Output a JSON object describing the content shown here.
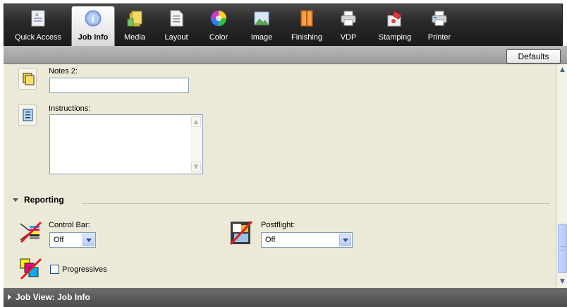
{
  "tabs": [
    {
      "label": "Quick Access",
      "icon": "quick-access-icon"
    },
    {
      "label": "Job Info",
      "icon": "info-icon",
      "active": true
    },
    {
      "label": "Media",
      "icon": "media-icon"
    },
    {
      "label": "Layout",
      "icon": "layout-icon"
    },
    {
      "label": "Color",
      "icon": "color-wheel-icon"
    },
    {
      "label": "Image",
      "icon": "image-icon"
    },
    {
      "label": "Finishing",
      "icon": "finishing-icon"
    },
    {
      "label": "VDP",
      "icon": "vdp-icon"
    },
    {
      "label": "Stamping",
      "icon": "stamping-icon"
    },
    {
      "label": "Printer",
      "icon": "printer-icon"
    }
  ],
  "toolbar": {
    "defaults_label": "Defaults"
  },
  "notes2": {
    "label": "Notes 2:",
    "value": ""
  },
  "instructions": {
    "label": "Instructions:",
    "value": ""
  },
  "reporting": {
    "title": "Reporting",
    "control_bar": {
      "label": "Control Bar:",
      "value": "Off"
    },
    "postflight": {
      "label": "Postflight:",
      "value": "Off"
    },
    "progressives": {
      "label": "Progressives",
      "checked": false
    }
  },
  "footer": {
    "label": "Job View: Job Info"
  },
  "colors": {
    "accent": "#7f9db9",
    "panel": "#ece9d8",
    "toolbar": "#2b2b2b"
  }
}
